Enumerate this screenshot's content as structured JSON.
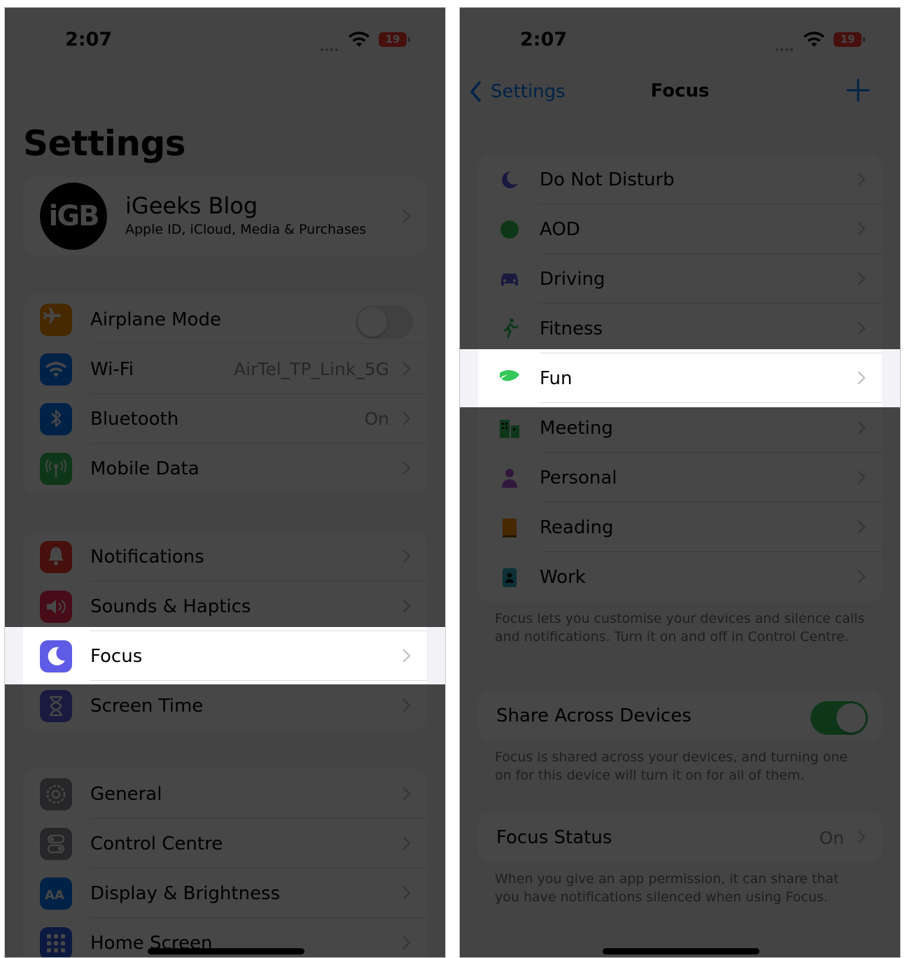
{
  "left": {
    "status": {
      "time": "2:07",
      "battery": "19"
    },
    "title": "Settings",
    "account": {
      "avatar_text": "iGB",
      "name": "iGeeks Blog",
      "subtitle": "Apple ID, iCloud, Media & Purchases"
    },
    "groups": [
      [
        {
          "label": "Airplane Mode",
          "icon": "airplane-icon",
          "color": "#ff9500",
          "toggle": false
        },
        {
          "label": "Wi-Fi",
          "icon": "wifi-icon",
          "color": "#007aff",
          "value": "AirTel_TP_Link_5G"
        },
        {
          "label": "Bluetooth",
          "icon": "bluetooth-icon",
          "color": "#007aff",
          "value": "On"
        },
        {
          "label": "Mobile Data",
          "icon": "antenna-icon",
          "color": "#34c759",
          "value": ""
        }
      ],
      [
        {
          "label": "Notifications",
          "icon": "bell-icon",
          "color": "#ff3b30",
          "value": ""
        },
        {
          "label": "Sounds & Haptics",
          "icon": "speaker-icon",
          "color": "#ff2d55",
          "value": ""
        },
        {
          "label": "Focus",
          "icon": "moon-icon",
          "color": "#5e5ce6",
          "value": "",
          "highlight": true
        },
        {
          "label": "Screen Time",
          "icon": "hourglass-icon",
          "color": "#5e5ce6",
          "value": ""
        }
      ],
      [
        {
          "label": "General",
          "icon": "gear-icon",
          "color": "#8e8e93",
          "value": ""
        },
        {
          "label": "Control Centre",
          "icon": "switches-icon",
          "color": "#8e8e93",
          "value": ""
        },
        {
          "label": "Display & Brightness",
          "icon": "text-size-icon",
          "color": "#007aff",
          "value": ""
        },
        {
          "label": "Home Screen",
          "icon": "grid-icon",
          "color": "#2c5be8",
          "value": ""
        }
      ]
    ]
  },
  "right": {
    "status": {
      "time": "2:07",
      "battery": "19"
    },
    "nav": {
      "back": "Settings",
      "title": "Focus"
    },
    "modes": [
      {
        "label": "Do Not Disturb",
        "icon": "moon-icon",
        "color": "#5e5ce6"
      },
      {
        "label": "AOD",
        "icon": "dot-icon",
        "color": "#34c759"
      },
      {
        "label": "Driving",
        "icon": "car-icon",
        "color": "#5e5ce6"
      },
      {
        "label": "Fitness",
        "icon": "runner-icon",
        "color": "#34c759"
      },
      {
        "label": "Fun",
        "icon": "leaf-icon",
        "color": "#34c759",
        "highlight": true
      },
      {
        "label": "Meeting",
        "icon": "building-icon",
        "color": "#34c759"
      },
      {
        "label": "Personal",
        "icon": "person-icon",
        "color": "#af52de"
      },
      {
        "label": "Reading",
        "icon": "book-icon",
        "color": "#ff9500"
      },
      {
        "label": "Work",
        "icon": "badge-icon",
        "color": "#30b0c7"
      }
    ],
    "focus_footer": "Focus lets you customise your devices and silence calls and notifications. Turn it on and off in Control Centre.",
    "share": {
      "label": "Share Across Devices",
      "toggle": true
    },
    "share_footer": "Focus is shared across your devices, and turning one on for this device will turn it on for all of them.",
    "status_row": {
      "label": "Focus Status",
      "value": "On"
    },
    "status_footer": "When you give an app permission, it can share that you have notifications silenced when using Focus."
  }
}
